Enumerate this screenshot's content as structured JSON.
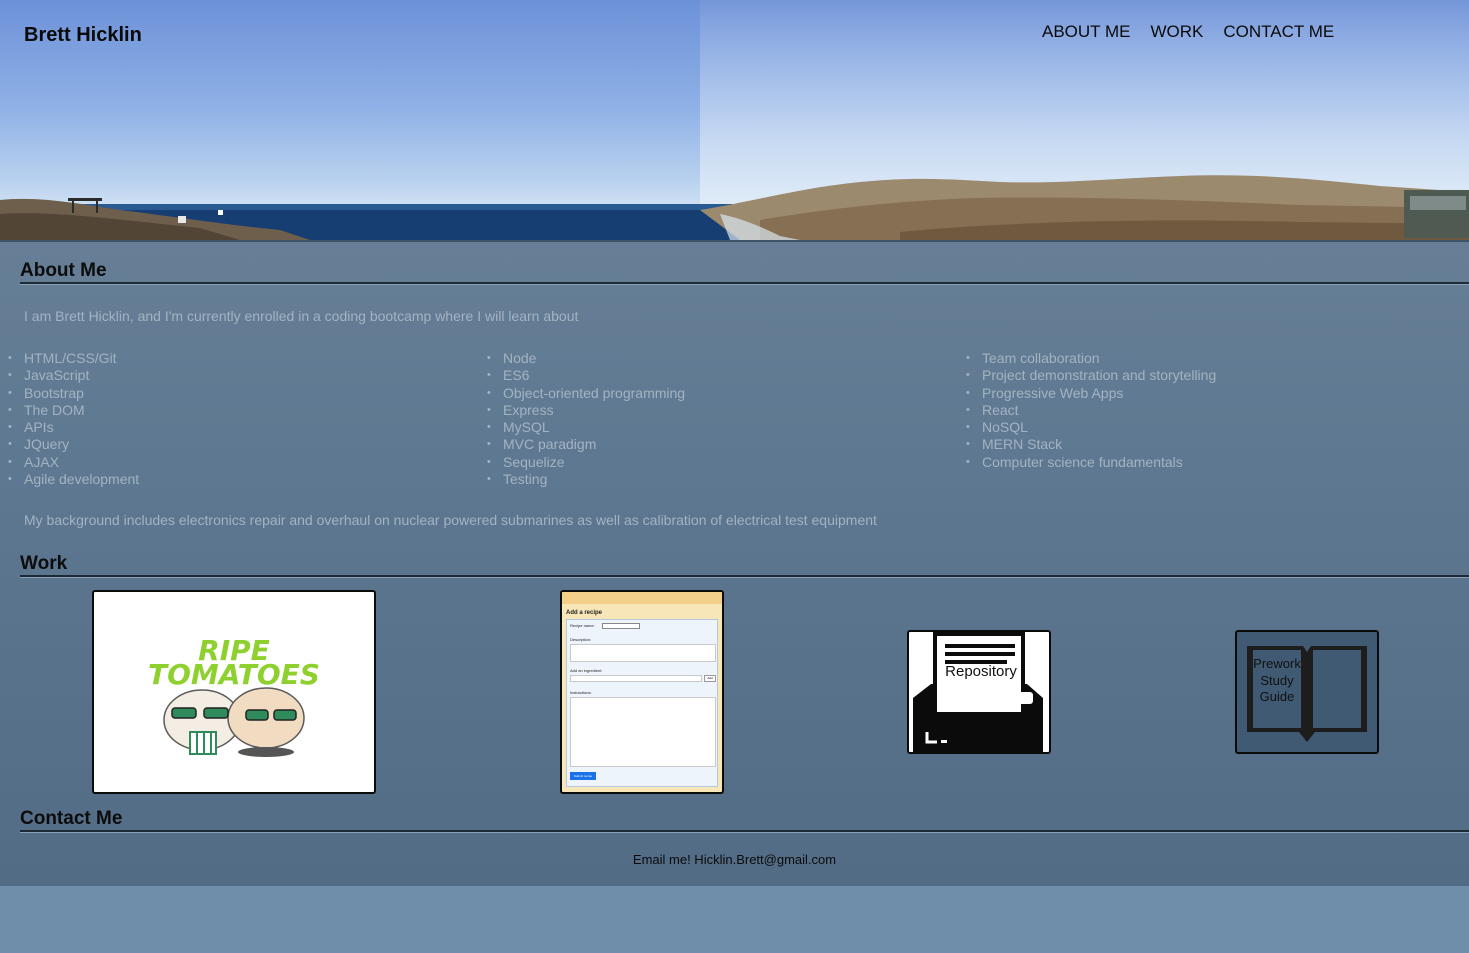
{
  "header": {
    "title": "Brett Hicklin",
    "nav": [
      "ABOUT ME",
      "WORK",
      "CONTACT ME"
    ]
  },
  "about": {
    "heading": "About Me",
    "intro": "I am Brett Hicklin, and I'm currently enrolled in a coding bootcamp where I will learn about",
    "skills_col1": [
      "HTML/CSS/Git",
      "JavaScript",
      "Bootstrap",
      "The DOM",
      "APIs",
      "JQuery",
      "AJAX",
      "Agile development"
    ],
    "skills_col2": [
      "Node",
      "ES6",
      "Object-oriented programming",
      "Express",
      "MySQL",
      "MVC paradigm",
      "Sequelize",
      "Testing"
    ],
    "skills_col3": [
      "Team collaboration",
      "Project demonstration and storytelling",
      "Progressive Web Apps",
      "React",
      "NoSQL",
      "MERN Stack",
      "Computer science fundamentals"
    ],
    "background": "My background includes electronics repair and overhaul on nuclear powered submarines as well as calibration of electrical test equipment"
  },
  "work": {
    "heading": "Work",
    "cards": [
      {
        "title_line1": "RIPE",
        "title_line2": "TOMATOES"
      },
      {
        "header_title": "Add a recipe",
        "field_recipe_name": "Recipe name:",
        "field_description": "Description:",
        "field_ingredient": "Add an ingredient:",
        "add_button": "Add",
        "field_instructions": "Instructions:",
        "submit_button": "Submit recipe"
      },
      {
        "label": "Repository"
      },
      {
        "line1": "Prework",
        "line2": "Study",
        "line3": "Guide"
      }
    ]
  },
  "contact": {
    "heading": "Contact Me",
    "email_text": "Email me! Hicklin.Brett@gmail.com"
  }
}
